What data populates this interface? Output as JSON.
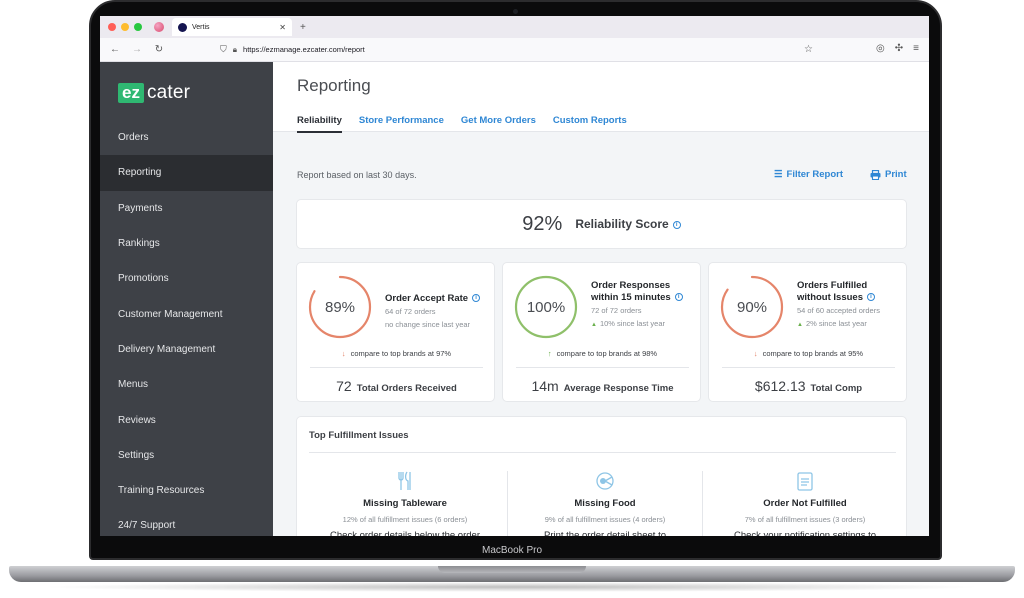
{
  "device": {
    "model_label": "MacBook Pro"
  },
  "browser": {
    "tab_title": "Vertis",
    "url": "https://ezmanage.ezcater.com/report",
    "icons": [
      "back-icon",
      "forward-icon",
      "reload-icon",
      "shield-icon",
      "lock-icon",
      "star-icon",
      "account-icon",
      "extensions-icon",
      "menu-icon"
    ]
  },
  "sidebar": {
    "logo": {
      "ez": "ez",
      "cater": "cater"
    },
    "items": [
      {
        "label": "Orders",
        "active": false
      },
      {
        "label": "Reporting",
        "active": true
      },
      {
        "label": "Payments",
        "active": false
      },
      {
        "label": "Rankings",
        "active": false
      },
      {
        "label": "Promotions",
        "active": false
      },
      {
        "label": "Customer Management",
        "active": false
      },
      {
        "label": "Delivery Management",
        "active": false
      },
      {
        "label": "Menus",
        "active": false
      },
      {
        "label": "Reviews",
        "active": false
      },
      {
        "label": "Settings",
        "active": false
      },
      {
        "label": "Training Resources",
        "active": false
      },
      {
        "label": "24/7 Support",
        "active": false
      }
    ]
  },
  "header": {
    "title": "Reporting",
    "tabs": [
      {
        "label": "Reliability",
        "active": true
      },
      {
        "label": "Store Performance",
        "active": false
      },
      {
        "label": "Get More Orders",
        "active": false
      },
      {
        "label": "Custom Reports",
        "active": false
      }
    ]
  },
  "toolbar": {
    "note": "Report based on last 30 days.",
    "filter_label": "Filter Report",
    "print_label": "Print"
  },
  "score": {
    "value": "92%",
    "label": "Reliability Score"
  },
  "metrics": [
    {
      "ring_value": "89%",
      "ring_fraction": 0.89,
      "ring_color": "#e5856a",
      "title_line1": "Order Accept Rate",
      "title_line2": "",
      "sub": "64 of 72 orders",
      "change": "no change since last year",
      "change_arrow": "",
      "compare": "compare to top brands at 97%",
      "compare_dir": "down",
      "total_value": "72",
      "total_label": "Total Orders Received"
    },
    {
      "ring_value": "100%",
      "ring_fraction": 1.0,
      "ring_color": "#8fc06a",
      "title_line1": "Order Responses",
      "title_line2": "within 15 minutes",
      "sub": "72 of 72 orders",
      "change": "10% since last year",
      "change_arrow": "▲",
      "compare": "compare to top brands at 98%",
      "compare_dir": "up",
      "total_value": "14m",
      "total_label": "Average Response Time"
    },
    {
      "ring_value": "90%",
      "ring_fraction": 0.9,
      "ring_color": "#e5856a",
      "title_line1": "Orders Fulfilled",
      "title_line2": "without Issues",
      "sub": "54 of 60 accepted orders",
      "change": "2% since last year",
      "change_arrow": "▲",
      "compare": "compare to top brands at 95%",
      "compare_dir": "down",
      "total_value": "$612.13",
      "total_label": "Total Comp"
    }
  ],
  "issues": {
    "title": "Top Fulfillment Issues",
    "items": [
      {
        "icon": "utensils-icon",
        "name": "Missing Tableware",
        "pct": "12% of all fulfillment issues (6 orders)",
        "desc": "Check order details below the order summary for Tableware requirements."
      },
      {
        "icon": "food-icon",
        "name": "Missing Food",
        "pct": "9% of all fulfillment issues (4 orders)",
        "desc": "Print the order detail sheet to reference order contents and make"
      },
      {
        "icon": "clipboard-icon",
        "name": "Order Not Fulfilled",
        "pct": "7% of all fulfillment issues (3 orders)",
        "desc": "Check your notification settings to make sure that the right people are"
      }
    ]
  },
  "colors": {
    "accent": "#2f87d4",
    "brand": "#2fb872",
    "sidebar": "#3e4147",
    "warn": "#e5856a",
    "good": "#8fc06a"
  }
}
